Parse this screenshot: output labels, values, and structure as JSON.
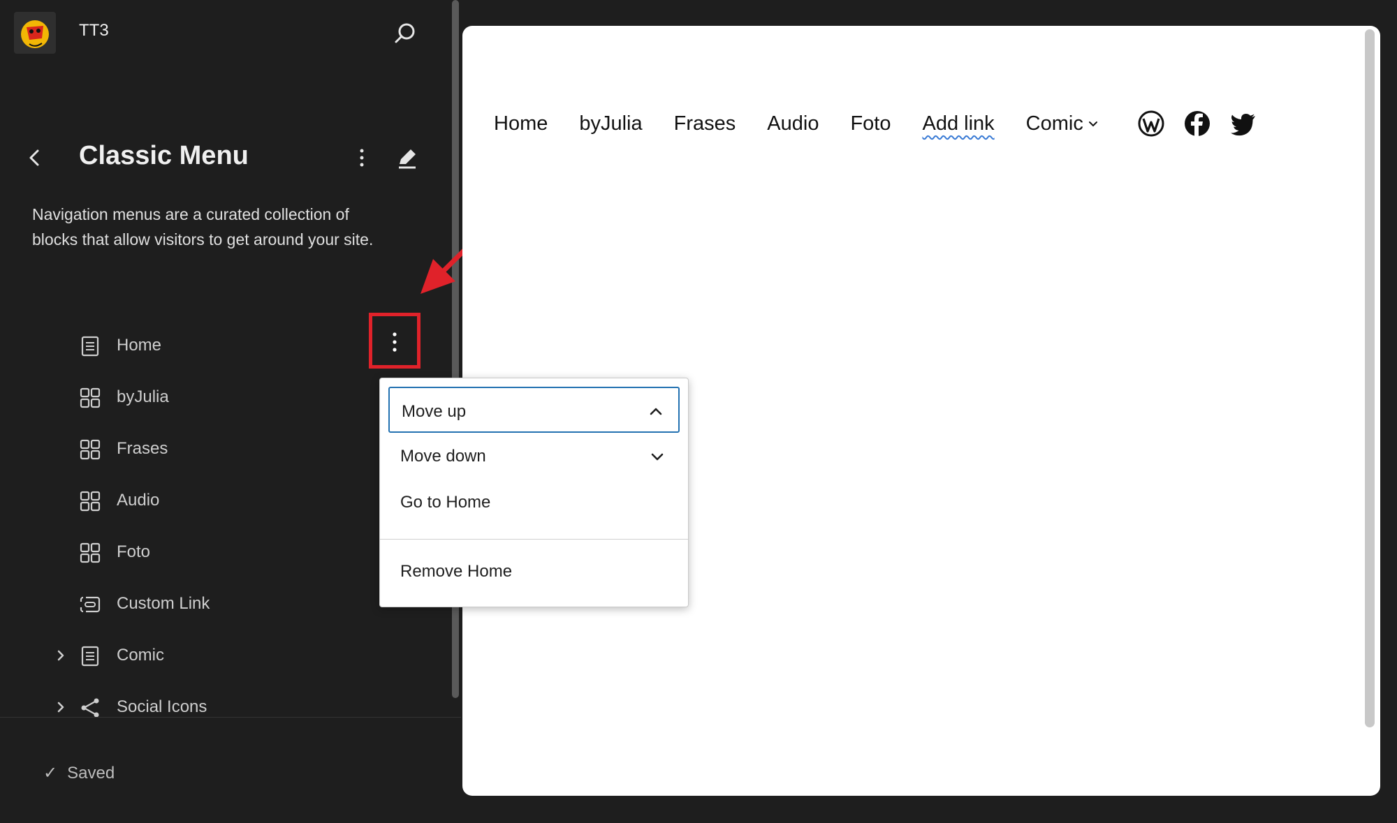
{
  "site": {
    "title": "TT3"
  },
  "panel": {
    "title": "Classic Menu",
    "description": "Navigation menus are a curated collection of blocks that allow visitors to get around your site."
  },
  "nav_items": [
    {
      "label": "Home",
      "icon": "page-icon",
      "expandable": false
    },
    {
      "label": "byJulia",
      "icon": "grid-icon",
      "expandable": false
    },
    {
      "label": "Frases",
      "icon": "grid-icon",
      "expandable": false
    },
    {
      "label": "Audio",
      "icon": "grid-icon",
      "expandable": false
    },
    {
      "label": "Foto",
      "icon": "grid-icon",
      "expandable": false
    },
    {
      "label": "Custom Link",
      "icon": "custom-link-icon",
      "expandable": false
    },
    {
      "label": "Comic",
      "icon": "page-icon",
      "expandable": true
    },
    {
      "label": "Social Icons",
      "icon": "share-icon",
      "expandable": true
    }
  ],
  "footer": {
    "status": "Saved"
  },
  "dropdown": {
    "move_up": "Move up",
    "move_down": "Move down",
    "go_to": "Go to Home",
    "remove": "Remove Home"
  },
  "preview_nav": {
    "links": [
      "Home",
      "byJulia",
      "Frases",
      "Audio",
      "Foto"
    ],
    "add_link": "Add link",
    "submenu": "Comic",
    "social": [
      "wordpress-icon",
      "facebook-icon",
      "twitter-icon"
    ]
  },
  "colors": {
    "sidebar_bg": "#1e1e1e",
    "highlight_red": "#e0222a",
    "focus_blue": "#2271b1",
    "canvas_bg": "#ffffff"
  }
}
